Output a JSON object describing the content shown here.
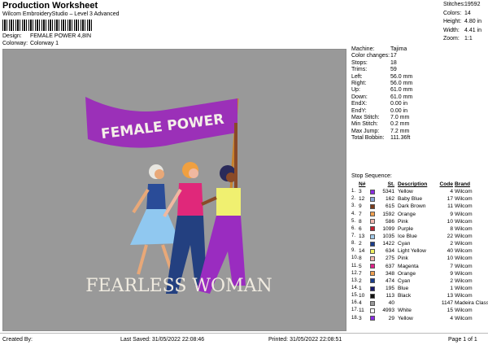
{
  "header": {
    "title": "Production Worksheet",
    "subtitle": "Wilcom EmbroideryStudio – Level 3 Advanced",
    "design_label": "Design:",
    "design_value": "FEMALE POWER 4,8IN",
    "colorway_label": "Colorway:",
    "colorway_value": "Colorway 1"
  },
  "stats": [
    {
      "label": "Stitches:",
      "value": "19592"
    },
    {
      "label": "Colors:",
      "value": "14"
    },
    {
      "label": "Height:",
      "value": "4.80 in"
    },
    {
      "label": "Width:",
      "value": "4.41 in"
    },
    {
      "label": "Zoom:",
      "value": "1:1"
    }
  ],
  "design": {
    "banner_text": "FEMALE POWER",
    "caption": "FEARLESS WOMAN"
  },
  "machine": [
    {
      "label": "Machine:",
      "value": "Tajima"
    },
    {
      "label": "Color changes:",
      "value": "17"
    },
    {
      "label": "Stops:",
      "value": "18"
    },
    {
      "label": "Trims:",
      "value": "59"
    },
    {
      "label": "Left:",
      "value": "56.0 mm"
    },
    {
      "label": "Right:",
      "value": "56.0 mm"
    },
    {
      "label": "Up:",
      "value": "61.0 mm"
    },
    {
      "label": "Down:",
      "value": "61.0 mm"
    },
    {
      "label": "EndX:",
      "value": "0.00 in"
    },
    {
      "label": "EndY:",
      "value": "0.00 in"
    },
    {
      "label": "Max Stitch:",
      "value": "7.0 mm"
    },
    {
      "label": "Min Stitch:",
      "value": "0.2 mm"
    },
    {
      "label": "Max Jump:",
      "value": "7.2 mm"
    },
    {
      "label": "Total Bobbin:",
      "value": "111.36ft"
    }
  ],
  "sequence": {
    "label": "Stop Sequence:",
    "headers": {
      "n": "N#",
      "st": "St.",
      "desc": "Description",
      "code": "Code",
      "brand": "Brand"
    },
    "rows": [
      {
        "idx": "1.",
        "n": "3",
        "color": "#8a2be2",
        "st": "5341",
        "desc": "Yellow",
        "code": "4",
        "brand": "Wilcom"
      },
      {
        "idx": "2.",
        "n": "12",
        "color": "#8aa8d8",
        "st": "162",
        "desc": "Baby Blue",
        "code": "17",
        "brand": "Wilcom"
      },
      {
        "idx": "3.",
        "n": "9",
        "color": "#7a3b1c",
        "st": "615",
        "desc": "Dark Brown",
        "code": "11",
        "brand": "Wilcom"
      },
      {
        "idx": "4.",
        "n": "7",
        "color": "#f0a050",
        "st": "1592",
        "desc": "Orange",
        "code": "9",
        "brand": "Wilcom"
      },
      {
        "idx": "5.",
        "n": "8",
        "color": "#f0b8b0",
        "st": "586",
        "desc": "Pink",
        "code": "10",
        "brand": "Wilcom"
      },
      {
        "idx": "6.",
        "n": "6",
        "color": "#c02030",
        "st": "1099",
        "desc": "Purple",
        "code": "8",
        "brand": "Wilcom"
      },
      {
        "idx": "7.",
        "n": "13",
        "color": "#a0c8e8",
        "st": "1035",
        "desc": "Ice Blue",
        "code": "22",
        "brand": "Wilcom"
      },
      {
        "idx": "8.",
        "n": "2",
        "color": "#1a3c8c",
        "st": "1422",
        "desc": "Cyan",
        "code": "2",
        "brand": "Wilcom"
      },
      {
        "idx": "9.",
        "n": "14",
        "color": "#f0f060",
        "st": "634",
        "desc": "Light Yellow",
        "code": "40",
        "brand": "Wilcom"
      },
      {
        "idx": "10.",
        "n": "8",
        "color": "#f0b8b0",
        "st": "275",
        "desc": "Pink",
        "code": "10",
        "brand": "Wilcom"
      },
      {
        "idx": "11.",
        "n": "5",
        "color": "#e0208a",
        "st": "637",
        "desc": "Magenta",
        "code": "7",
        "brand": "Wilcom"
      },
      {
        "idx": "12.",
        "n": "7",
        "color": "#f0a050",
        "st": "348",
        "desc": "Orange",
        "code": "9",
        "brand": "Wilcom"
      },
      {
        "idx": "13.",
        "n": "2",
        "color": "#1a3c8c",
        "st": "474",
        "desc": "Cyan",
        "code": "2",
        "brand": "Wilcom"
      },
      {
        "idx": "14.",
        "n": "1",
        "color": "#1a1a6c",
        "st": "195",
        "desc": "Blue",
        "code": "1",
        "brand": "Wilcom"
      },
      {
        "idx": "15.",
        "n": "10",
        "color": "#111111",
        "st": "113",
        "desc": "Black",
        "code": "13",
        "brand": "Wilcom"
      },
      {
        "idx": "16.",
        "n": "4",
        "color": "#999999",
        "st": "40",
        "desc": "",
        "code": "1147",
        "brand": "Madeira Classic 40"
      },
      {
        "idx": "17.",
        "n": "11",
        "color": "#ffffff",
        "st": "4993",
        "desc": "White",
        "code": "15",
        "brand": "Wilcom"
      },
      {
        "idx": "18.",
        "n": "3",
        "color": "#8a2be2",
        "st": "29",
        "desc": "Yellow",
        "code": "4",
        "brand": "Wilcom"
      }
    ]
  },
  "footer": {
    "created": "Created By:",
    "saved": "Last Saved: 31/05/2022 22:08:46",
    "printed": "Printed: 31/05/2022 22:08:51",
    "page": "Page 1 of 1"
  }
}
